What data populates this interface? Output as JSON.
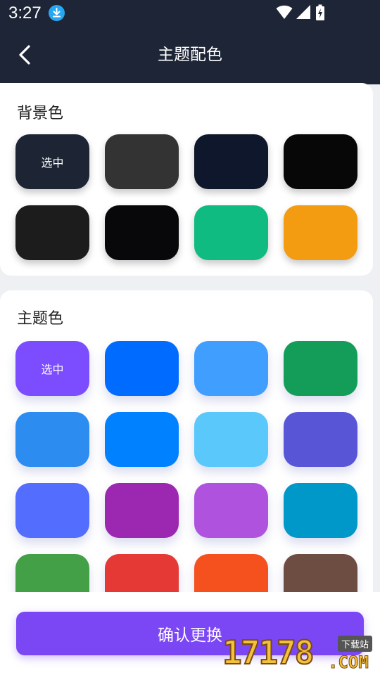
{
  "status_bar": {
    "time": "3:27"
  },
  "app_bar": {
    "title": "主题配色"
  },
  "background_section": {
    "title": "背景色",
    "selected_label": "选中",
    "swatches": [
      {
        "color": "#1d2534",
        "selected": true
      },
      {
        "color": "#333333",
        "selected": false
      },
      {
        "color": "#0e172b",
        "selected": false
      },
      {
        "color": "#070707",
        "selected": false
      },
      {
        "color": "#1c1c1d",
        "selected": false
      },
      {
        "color": "#08080a",
        "selected": false
      },
      {
        "color": "#10bb82",
        "selected": false
      },
      {
        "color": "#f39c12",
        "selected": false
      }
    ]
  },
  "theme_section": {
    "title": "主题色",
    "selected_label": "选中",
    "swatches": [
      {
        "color": "#7c4dff",
        "selected": true
      },
      {
        "color": "#006cff",
        "selected": false
      },
      {
        "color": "#409eff",
        "selected": false
      },
      {
        "color": "#149d58",
        "selected": false
      },
      {
        "color": "#2d8cf0",
        "selected": false
      },
      {
        "color": "#0081ff",
        "selected": false
      },
      {
        "color": "#5ac8fa",
        "selected": false
      },
      {
        "color": "#5856d6",
        "selected": false
      },
      {
        "color": "#536dfe",
        "selected": false
      },
      {
        "color": "#9c27b0",
        "selected": false
      },
      {
        "color": "#af52de",
        "selected": false
      },
      {
        "color": "#0097c9",
        "selected": false
      },
      {
        "color": "#43a047",
        "selected": false
      },
      {
        "color": "#e53935",
        "selected": false
      },
      {
        "color": "#f4511e",
        "selected": false
      },
      {
        "color": "#6d4c41",
        "selected": false
      }
    ]
  },
  "confirm_button": {
    "label": "确认更换"
  },
  "watermark": {
    "text": "17178",
    "suffix": ".COM",
    "badge": "下载站"
  }
}
